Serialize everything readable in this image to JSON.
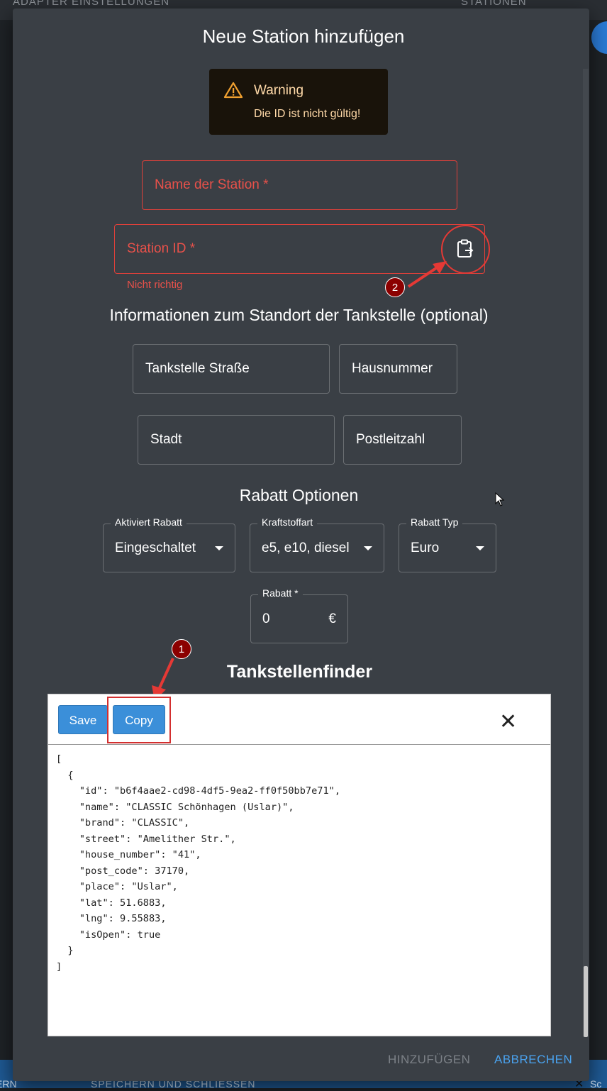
{
  "background": {
    "topbar_left": "ADAPTER EINSTELLUNGEN",
    "topbar_right": "STATIONEN",
    "bottombar_left": "ERN",
    "bottombar_center": "SPEICHERN UND SCHLIESSEN",
    "bottombar_right": "Sc"
  },
  "dialog": {
    "title": "Neue Station hinzufügen",
    "warning": {
      "title": "Warning",
      "message": "Die ID ist nicht gültig!"
    },
    "fields": {
      "station_name": "Name der Station *",
      "station_id": "Station ID *",
      "station_id_helper": "Nicht richtig"
    },
    "location_section": "Informationen zum Standort der Tankstelle (optional)",
    "location_fields": {
      "street": "Tankstelle Straße",
      "house_number": "Hausnummer",
      "city": "Stadt",
      "postcode": "Postleitzahl"
    },
    "discount_section": "Rabatt Optionen",
    "discount": {
      "activated_label": "Aktiviert Rabatt",
      "activated_value": "Eingeschaltet",
      "fuel_label": "Kraftstoffart",
      "fuel_value": "e5, e10, diesel",
      "type_label": "Rabatt Typ",
      "type_value": "Euro",
      "amount_label": "Rabatt *",
      "amount_value": "0",
      "amount_unit": "€"
    },
    "finder_title": "Tankstellenfinder",
    "editor": {
      "save_label": "Save",
      "copy_label": "Copy",
      "close_glyph": "✕",
      "json_text": "[\n  {\n    \"id\": \"b6f4aae2-cd98-4df5-9ea2-ff0f50bb7e71\",\n    \"name\": \"CLASSIC Schönhagen (Uslar)\",\n    \"brand\": \"CLASSIC\",\n    \"street\": \"Amelither Str.\",\n    \"house_number\": \"41\",\n    \"post_code\": 37170,\n    \"place\": \"Uslar\",\n    \"lat\": 51.6883,\n    \"lng\": 9.55883,\n    \"isOpen\": true\n  }\n]"
    },
    "annotations": {
      "badge_1": "1",
      "badge_2": "2"
    },
    "actions": {
      "add": "HINZUFÜGEN",
      "cancel": "ABBRECHEN"
    }
  },
  "colors": {
    "dialog_bg": "#3a3f45",
    "error": "#e8514a",
    "accent": "#4aa3f0",
    "button_blue": "#3b8fd9",
    "annotation_red": "#d32f2f"
  },
  "icons": [
    "warning-icon",
    "paste-icon",
    "close-icon",
    "dropdown-caret-icon",
    "mouse-cursor-icon"
  ]
}
